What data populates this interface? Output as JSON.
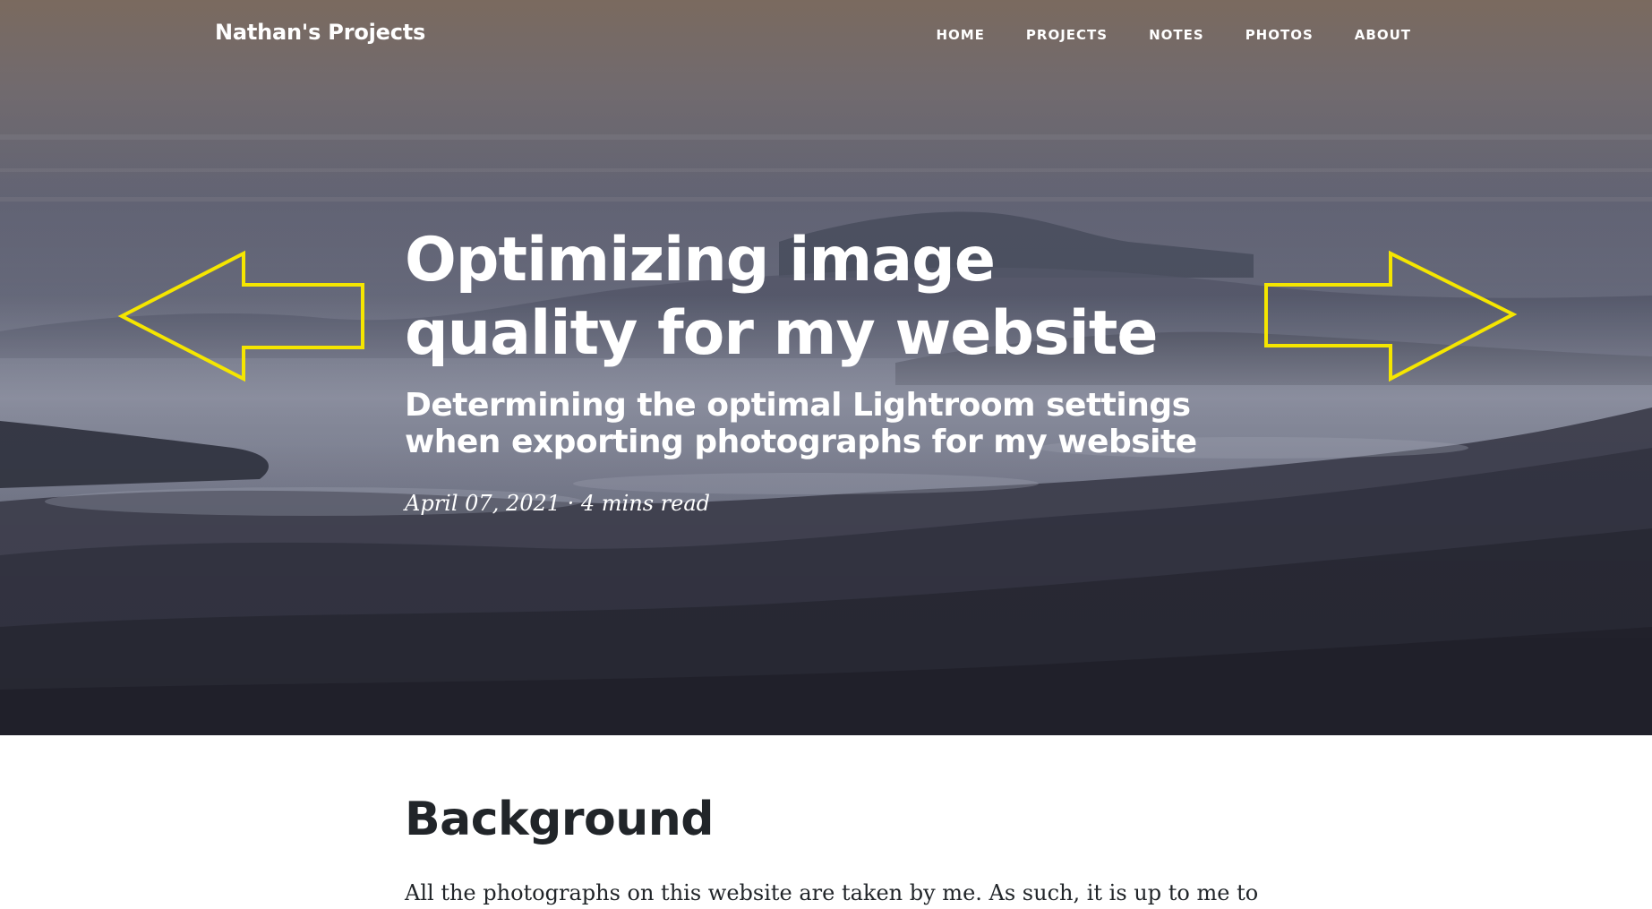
{
  "nav": {
    "brand": "Nathan's Projects",
    "links": [
      "HOME",
      "PROJECTS",
      "NOTES",
      "PHOTOS",
      "ABOUT"
    ]
  },
  "hero": {
    "title": "Optimizing image quality for my website",
    "subtitle": "Determining the optimal Lightroom settings when exporting photographs for my website",
    "meta": "April 07, 2021 · 4 mins read",
    "background": "misty-mountain-valley-photo"
  },
  "annotations": {
    "color": "#f5e600",
    "left_arrow": "arrow-left-icon",
    "right_arrow": "arrow-right-icon"
  },
  "content": {
    "heading": "Background",
    "paragraph_start": "All the photographs on this website are taken by me. As such, it is up to me to"
  }
}
